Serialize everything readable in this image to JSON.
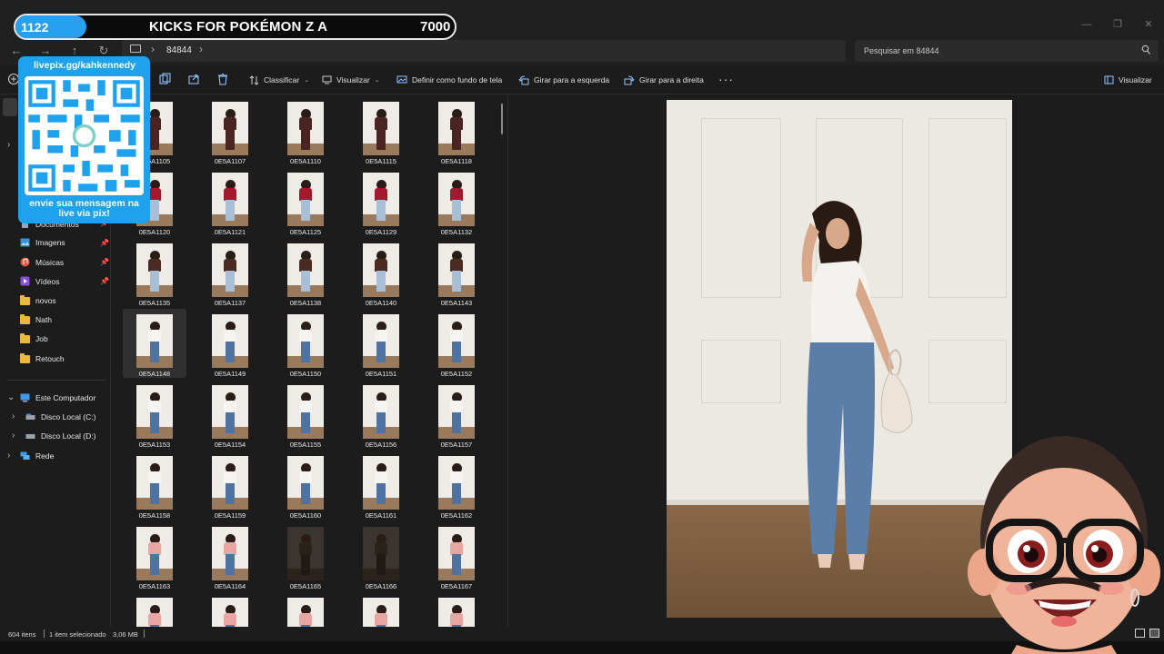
{
  "overlay": {
    "count": "1122",
    "title": "KICKS FOR POKÉMON Z A",
    "goal": "7000",
    "qr_url": "livepix.gg/kahkennedy",
    "qr_message": "envie sua mensagem na live via pix!"
  },
  "address": {
    "current_folder": "84844",
    "search_placeholder": "Pesquisar em 84844"
  },
  "toolbar": {
    "sort_label": "Classificar",
    "view_label": "Visualizar",
    "set_wallpaper_label": "Definir como fundo de tela",
    "rotate_left_label": "Girar para a esquerda",
    "rotate_right_label": "Girar para a direita",
    "preview_label": "Visualizar"
  },
  "sidebar": {
    "items": [
      {
        "label": "Documentos",
        "icon": "documents-icon",
        "pinned": true
      },
      {
        "label": "Imagens",
        "icon": "pictures-icon",
        "pinned": true
      },
      {
        "label": "Músicas",
        "icon": "music-icon",
        "pinned": true
      },
      {
        "label": "Vídeos",
        "icon": "videos-icon",
        "pinned": true
      },
      {
        "label": "novos",
        "icon": "folder-icon",
        "pinned": false
      },
      {
        "label": "Nath",
        "icon": "folder-icon",
        "pinned": false
      },
      {
        "label": "Job",
        "icon": "folder-icon",
        "pinned": false
      },
      {
        "label": "Retouch",
        "icon": "folder-icon",
        "pinned": false
      }
    ],
    "this_pc": "Este Computador",
    "drives": [
      "Disco Local (C:)",
      "Disco Local (D:)"
    ],
    "network": "Rede"
  },
  "files": [
    "0E5A1105",
    "0E5A1107",
    "0E5A1110",
    "0E5A1115",
    "0E5A1118",
    "0E5A1120",
    "0E5A1121",
    "0E5A1125",
    "0E5A1129",
    "0E5A1132",
    "0E5A1135",
    "0E5A1137",
    "0E5A1138",
    "0E5A1140",
    "0E5A1143",
    "0E5A1148",
    "0E5A1149",
    "0E5A1150",
    "0E5A1151",
    "0E5A1152",
    "0E5A1153",
    "0E5A1154",
    "0E5A1155",
    "0E5A1156",
    "0E5A1157",
    "0E5A1158",
    "0E5A1159",
    "0E5A1160",
    "0E5A1161",
    "0E5A1162",
    "0E5A1163",
    "0E5A1164",
    "0E5A1165",
    "0E5A1166",
    "0E5A1167",
    "",
    "",
    "",
    "",
    ""
  ],
  "selected_file": "0E5A1148",
  "status": {
    "items_count": "604 itens",
    "selection": "1 item selecionado",
    "size": "3,06 MB"
  }
}
